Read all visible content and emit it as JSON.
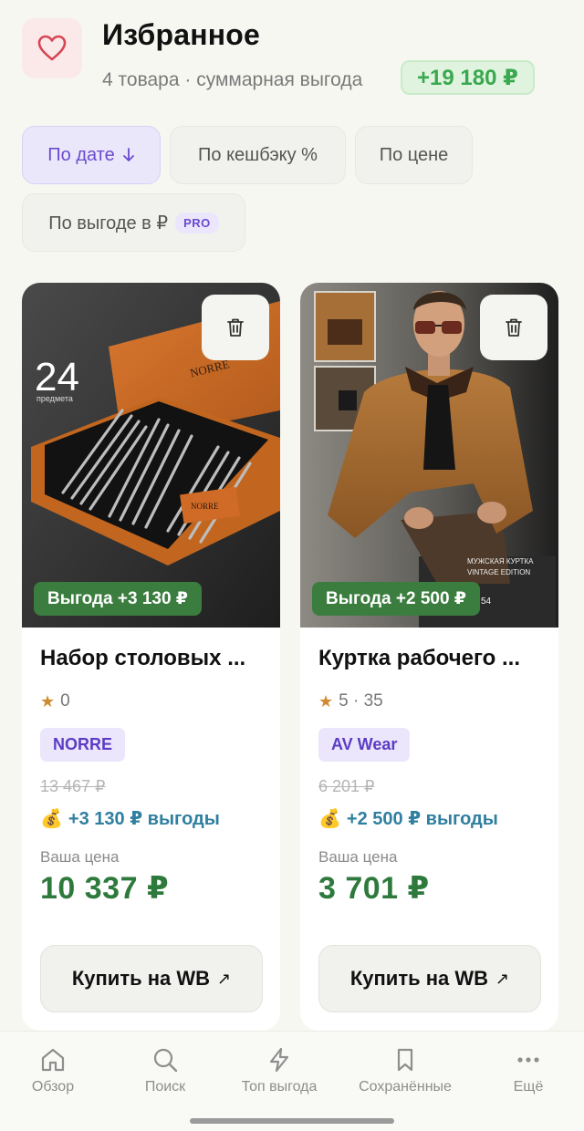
{
  "header": {
    "title": "Избранное",
    "subtitle": "4 товара · суммарная выгода",
    "total_savings": "+19 180 ₽",
    "icon": "heart-icon"
  },
  "sort": {
    "by_date": "По дате",
    "by_cashback": "По кешбэку %",
    "by_price": "По цене",
    "by_profit": "По выгоде в ₽",
    "pro_badge": "PRO",
    "active": "by_date"
  },
  "products": [
    {
      "title": "Набор столовых ...",
      "rating": "0",
      "brand": "NORRE",
      "old_price": "13 467 ₽",
      "bonus": "+3 130 ₽ выгоды",
      "price_label": "Ваша цена",
      "price": "10 337 ₽",
      "profit_tag": "Выгода +3 130 ₽",
      "buy_label": "Купить на WB",
      "image_overlay_number": "24",
      "image_overlay_caption": "предмета",
      "image_box_brand": "NORRE"
    },
    {
      "title": "Куртка рабочего ...",
      "rating": "5 · 35",
      "brand": "AV Wear",
      "old_price": "6 201 ₽",
      "bonus": "+2 500 ₽ выгоды",
      "price_label": "Ваша цена",
      "price": "3 701 ₽",
      "profit_tag": "Выгода +2 500 ₽",
      "buy_label": "Купить на WB",
      "image_caption_line1": "МУЖСКАЯ КУРТКА",
      "image_caption_line2": "VINTAGE EDITION",
      "image_caption_line3": "54"
    }
  ],
  "nav": {
    "items": [
      {
        "label": "Обзор",
        "icon": "home-icon"
      },
      {
        "label": "Поиск",
        "icon": "search-icon"
      },
      {
        "label": "Топ выгода",
        "icon": "lightning-icon"
      },
      {
        "label": "Сохранённые",
        "icon": "bookmark-icon"
      },
      {
        "label": "Ещё",
        "icon": "more-icon"
      }
    ]
  },
  "colors": {
    "accent_purple": "#6a4bd0",
    "savings_green": "#3aa84f",
    "price_green": "#2e7a3c",
    "profit_tag_green": "#3b7d3f",
    "bonus_blue": "#2f7fa0",
    "star_orange": "#d08a2f",
    "heart_red": "#d64552"
  }
}
